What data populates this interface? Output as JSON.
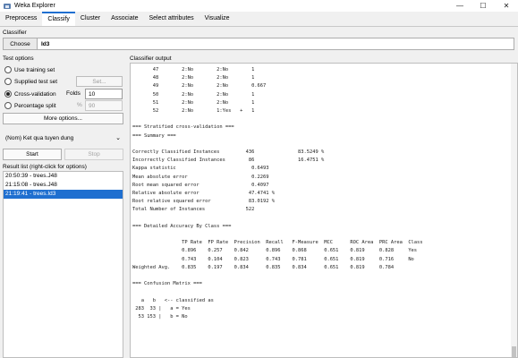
{
  "window": {
    "title": "Weka Explorer",
    "minimize": "—",
    "maximize": "☐",
    "close": "✕"
  },
  "tabs": [
    "Preprocess",
    "Classify",
    "Cluster",
    "Associate",
    "Select attributes",
    "Visualize"
  ],
  "active_tab": "Classify",
  "classifier": {
    "section_label": "Classifier",
    "choose_label": "Choose",
    "name": "Id3"
  },
  "test_options": {
    "section_label": "Test options",
    "use_training_set": "Use training set",
    "supplied_test_set": "Supplied test set",
    "set_button": "Set...",
    "cross_validation": "Cross-validation",
    "folds_label": "Folds",
    "folds_value": "10",
    "percentage_split": "Percentage split",
    "percent_symbol": "%",
    "percent_value": "90",
    "more_options": "More options...",
    "selected": "Cross-validation"
  },
  "class_select": {
    "value": "(Nom) Ket qua tuyen dung",
    "chevron": "⌄"
  },
  "actions": {
    "start": "Start",
    "stop": "Stop"
  },
  "result_list": {
    "label": "Result list (right-click for options)",
    "items": [
      "20:50:39 - trees.J48",
      "21:15:08 - trees.J48",
      "21:19:41 - trees.Id3"
    ],
    "selected_index": 2
  },
  "output": {
    "label": "Classifier output",
    "lines": [
      "       47        2:No        2:No        1",
      "       48        2:No        2:No        1",
      "       49        2:No        2:No        0.667",
      "       50        2:No        2:No        1",
      "       51        2:No        2:No        1",
      "       52        2:No        1:Yes   +   1",
      "",
      "=== Stratified cross-validation ===",
      "=== Summary ===",
      "",
      "Correctly Classified Instances         436               83.5249 %",
      "Incorrectly Classified Instances        86               16.4751 %",
      "Kappa statistic                          0.6493",
      "Mean absolute error                      0.2269",
      "Root mean squared error                  0.4097",
      "Relative absolute error                 47.4741 %",
      "Root relative squared error             83.0192 %",
      "Total Number of Instances              522",
      "",
      "=== Detailed Accuracy By Class ===",
      "",
      "                 TP Rate  FP Rate  Precision  Recall   F-Measure  MCC      ROC Area  PRC Area  Class",
      "                 0.896    0.257    0.842      0.896    0.868      0.651    0.819     0.828     Yes",
      "                 0.743    0.104    0.823      0.743    0.781      0.651    0.819     0.716     No",
      "Weighted Avg.    0.835    0.197    0.834      0.835    0.834      0.651    0.819     0.784",
      "",
      "=== Confusion Matrix ===",
      "",
      "   a   b   <-- classified as",
      " 283  33 |   a = Yes",
      "  53 153 |   b = No"
    ]
  }
}
